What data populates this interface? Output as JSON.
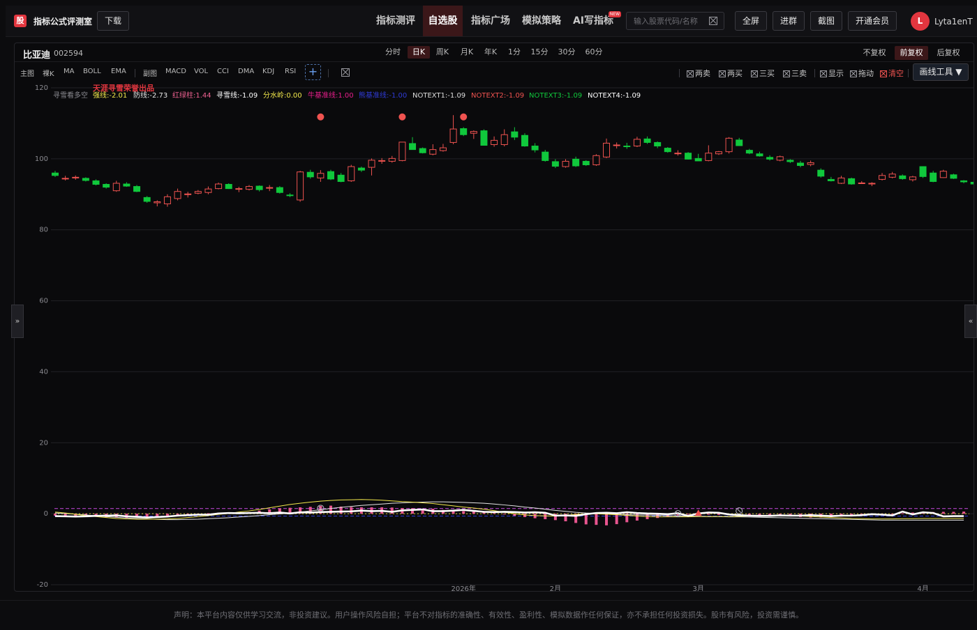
{
  "header": {
    "logo_char": "股",
    "app_title": "指标公式评测室",
    "download_label": "下载",
    "nav": [
      {
        "label": "指标测评",
        "active": false
      },
      {
        "label": "自选股",
        "active": true
      },
      {
        "label": "指标广场",
        "active": false
      },
      {
        "label": "模拟策略",
        "active": false
      },
      {
        "label": "AI写指标",
        "active": false
      }
    ],
    "new_badge": "NEW",
    "search_placeholder": "输入股票代码/名称",
    "buttons": [
      "全屏",
      "进群",
      "截图",
      "开通会员"
    ],
    "avatar_letter": "L",
    "username": "Lyta1enT"
  },
  "stock": {
    "name": "比亚迪",
    "code": "002594"
  },
  "periods": [
    {
      "label": "分时",
      "active": false
    },
    {
      "label": "日K",
      "active": true
    },
    {
      "label": "周K",
      "active": false
    },
    {
      "label": "月K",
      "active": false
    },
    {
      "label": "年K",
      "active": false
    },
    {
      "label": "1分",
      "active": false
    },
    {
      "label": "15分",
      "active": false
    },
    {
      "label": "30分",
      "active": false
    },
    {
      "label": "60分",
      "active": false
    }
  ],
  "adjustments": [
    {
      "label": "不复权",
      "active": false
    },
    {
      "label": "前复权",
      "active": true
    },
    {
      "label": "后复权",
      "active": false
    }
  ],
  "indicator_bar": {
    "main_label": "主图",
    "main_items": [
      "裸K",
      "MA",
      "BOLL",
      "EMA"
    ],
    "sub_label": "副图",
    "sub_items": [
      "MACD",
      "VOL",
      "CCI",
      "DMA",
      "KDJ",
      "RSI"
    ],
    "add_symbol": "+"
  },
  "tools": [
    {
      "label": "两卖",
      "clear": false
    },
    {
      "label": "两买",
      "clear": false
    },
    {
      "label": "三买",
      "clear": false
    },
    {
      "label": "三卖",
      "clear": false
    },
    {
      "label": "显示",
      "clear": false
    },
    {
      "label": "拖动",
      "clear": false
    },
    {
      "label": "清空",
      "clear": true
    }
  ],
  "draw_tools_label": "画线工具 ▼",
  "side_buttons": {
    "left": "»",
    "right": "«"
  },
  "colors": {
    "up": "#ef5350",
    "down": "#10c83c",
    "accent": "#e2363f",
    "gridline": "#222226"
  },
  "chart_data": {
    "type": "candlestick",
    "watermark": "天涯寻雪荣誉出品",
    "formula_name": "寻雪看多空",
    "legend": [
      {
        "name": "强线",
        "value": "-2.01",
        "color": "#f2e84b"
      },
      {
        "name": "防线",
        "value": "-2.73",
        "color": "#e6e6e6"
      },
      {
        "name": "红绿柱",
        "value": "1.44",
        "color": "#f06292"
      },
      {
        "name": "寻雪线",
        "value": "-1.09",
        "color": "#ffffff"
      },
      {
        "name": "分水岭",
        "value": "0.00",
        "color": "#f2e84b"
      },
      {
        "name": "牛基准线",
        "value": "1.00",
        "color": "#e91e8c"
      },
      {
        "name": "熊基准线",
        "value": "-1.00",
        "color": "#2f3bd6"
      },
      {
        "name": "NOTEXT1",
        "value": "-1.09",
        "color": "#dddddd"
      },
      {
        "name": "NOTEXT2",
        "value": "-1.09",
        "color": "#ef5350"
      },
      {
        "name": "NOTEXT3",
        "value": "-1.09",
        "color": "#10c83c"
      },
      {
        "name": "NOTEXT4",
        "value": "-1.09",
        "color": "#ffffff"
      }
    ],
    "y_ticks": [
      120,
      100,
      80,
      60,
      40,
      20,
      0,
      -20
    ],
    "ylim": [
      -20,
      120
    ],
    "x_labels": [
      {
        "label": "2026年",
        "index": 40
      },
      {
        "label": "2月",
        "index": 49
      },
      {
        "label": "3月",
        "index": 63
      },
      {
        "label": "4月",
        "index": 85
      }
    ],
    "candles": [
      [
        96.0,
        96.6,
        94.9,
        95.3
      ],
      [
        94.5,
        95.2,
        93.9,
        94.5
      ],
      [
        94.6,
        95.3,
        94.1,
        94.8
      ],
      [
        94.5,
        94.8,
        93.6,
        93.9
      ],
      [
        93.8,
        94.2,
        92.5,
        92.8
      ],
      [
        92.8,
        93.1,
        91.6,
        92.0
      ],
      [
        91.0,
        93.8,
        90.7,
        93.1
      ],
      [
        92.9,
        93.4,
        92.1,
        92.3
      ],
      [
        92.2,
        92.6,
        90.6,
        90.8
      ],
      [
        89.1,
        89.5,
        87.6,
        88.0
      ],
      [
        87.6,
        88.3,
        86.6,
        87.9
      ],
      [
        87.3,
        90.0,
        86.5,
        89.3
      ],
      [
        88.8,
        91.6,
        88.3,
        90.8
      ],
      [
        89.9,
        90.7,
        89.1,
        90.1
      ],
      [
        90.3,
        91.2,
        90.0,
        90.8
      ],
      [
        90.5,
        92.2,
        90.0,
        91.5
      ],
      [
        91.6,
        93.3,
        91.4,
        92.9
      ],
      [
        92.8,
        93.1,
        91.5,
        91.6
      ],
      [
        91.5,
        92.1,
        90.6,
        91.6
      ],
      [
        91.4,
        92.6,
        91.1,
        92.2
      ],
      [
        92.3,
        92.5,
        90.8,
        91.3
      ],
      [
        91.7,
        92.6,
        90.9,
        91.9
      ],
      [
        91.9,
        92.3,
        90.2,
        90.5
      ],
      [
        89.8,
        90.3,
        89.2,
        89.6
      ],
      [
        88.4,
        96.6,
        87.9,
        96.3
      ],
      [
        96.2,
        96.9,
        94.4,
        94.9
      ],
      [
        94.6,
        96.8,
        93.5,
        95.9
      ],
      [
        96.4,
        96.9,
        94.0,
        94.3
      ],
      [
        95.4,
        96.0,
        93.4,
        93.6
      ],
      [
        93.8,
        98.3,
        93.5,
        97.8
      ],
      [
        97.4,
        97.8,
        96.3,
        96.8
      ],
      [
        97.6,
        100.1,
        95.3,
        99.6
      ],
      [
        99.3,
        100.2,
        98.6,
        99.5
      ],
      [
        99.3,
        100.8,
        98.9,
        100.1
      ],
      [
        99.5,
        104.7,
        99.3,
        104.7
      ],
      [
        104.3,
        106.1,
        102.6,
        102.6
      ],
      [
        102.9,
        103.2,
        101.5,
        101.7
      ],
      [
        101.3,
        104.1,
        101.0,
        102.6
      ],
      [
        102.3,
        104.2,
        102.0,
        103.1
      ],
      [
        104.6,
        112.3,
        104.1,
        108.4
      ],
      [
        108.5,
        108.9,
        106.4,
        106.8
      ],
      [
        107.2,
        108.0,
        105.6,
        107.7
      ],
      [
        107.9,
        108.3,
        103.7,
        103.8
      ],
      [
        104.0,
        106.3,
        103.4,
        105.2
      ],
      [
        104.0,
        108.3,
        103.5,
        106.8
      ],
      [
        107.6,
        108.9,
        105.3,
        106.1
      ],
      [
        106.6,
        107.2,
        103.4,
        103.6
      ],
      [
        103.6,
        104.4,
        101.8,
        102.5
      ],
      [
        101.9,
        102.5,
        99.2,
        99.5
      ],
      [
        99.2,
        99.9,
        97.4,
        97.9
      ],
      [
        97.8,
        99.9,
        97.5,
        99.3
      ],
      [
        99.9,
        100.6,
        97.7,
        98.0
      ],
      [
        99.3,
        99.6,
        98.0,
        98.3
      ],
      [
        98.3,
        101.3,
        98.0,
        100.9
      ],
      [
        100.5,
        105.7,
        100.2,
        104.4
      ],
      [
        103.8,
        104.6,
        102.9,
        103.9
      ],
      [
        103.6,
        104.5,
        102.8,
        103.4
      ],
      [
        103.6,
        106.2,
        103.3,
        105.5
      ],
      [
        105.6,
        106.3,
        104.2,
        104.6
      ],
      [
        104.6,
        104.9,
        103.0,
        103.6
      ],
      [
        103.0,
        103.3,
        101.7,
        102.0
      ],
      [
        101.6,
        102.4,
        100.9,
        101.6
      ],
      [
        101.6,
        101.9,
        99.8,
        99.9
      ],
      [
        100.1,
        101.4,
        99.7,
        99.4
      ],
      [
        99.5,
        103.8,
        99.3,
        101.6
      ],
      [
        101.4,
        102.2,
        101.1,
        102.0
      ],
      [
        102.0,
        106.1,
        101.5,
        105.8
      ],
      [
        105.3,
        105.9,
        103.6,
        103.7
      ],
      [
        102.4,
        102.8,
        101.3,
        101.6
      ],
      [
        101.4,
        102.0,
        100.6,
        100.8
      ],
      [
        100.4,
        101.0,
        99.5,
        99.9
      ],
      [
        99.6,
        100.9,
        99.3,
        100.6
      ],
      [
        99.6,
        99.9,
        98.8,
        99.2
      ],
      [
        98.8,
        99.4,
        97.6,
        98.1
      ],
      [
        98.4,
        99.5,
        97.9,
        98.9
      ],
      [
        96.8,
        97.3,
        94.7,
        95.1
      ],
      [
        94.2,
        94.9,
        93.6,
        93.8
      ],
      [
        93.1,
        95.2,
        92.9,
        94.6
      ],
      [
        94.4,
        94.7,
        92.7,
        92.9
      ],
      [
        93.1,
        93.7,
        92.9,
        93.2
      ],
      [
        92.9,
        93.4,
        92.3,
        93.1
      ],
      [
        94.2,
        96.0,
        93.9,
        95.3
      ],
      [
        94.8,
        96.3,
        94.5,
        95.7
      ],
      [
        95.2,
        95.6,
        94.1,
        94.4
      ],
      [
        94.1,
        95.2,
        93.6,
        94.9
      ],
      [
        97.8,
        97.9,
        94.6,
        95.0
      ],
      [
        96.0,
        96.6,
        93.4,
        93.6
      ],
      [
        94.7,
        96.9,
        94.6,
        96.5
      ],
      [
        95.5,
        95.8,
        94.3,
        94.5
      ],
      [
        93.8,
        94.0,
        93.1,
        93.5
      ],
      [
        93.4,
        93.6,
        92.7,
        92.9
      ],
      [
        93.4,
        93.8,
        92.6,
        93.0
      ]
    ],
    "markers": [
      {
        "index": 26,
        "type": "dot",
        "value": 111.8
      },
      {
        "index": 34,
        "type": "dot",
        "value": 111.8
      },
      {
        "index": 40,
        "type": "dot",
        "value": 111.8
      }
    ],
    "indicator": {
      "bull_line": 1.0,
      "bear_line": -1.0,
      "zero_line": 0.0,
      "histogram": [
        -0.8,
        -0.9,
        -1.1,
        -1.2,
        -1.3,
        -1.5,
        -1.6,
        -1.8,
        -1.6,
        -1.3,
        -1.5,
        -1.2,
        -0.9,
        -0.6,
        -0.3,
        0.2,
        0.4,
        0.3,
        0.5,
        0.7,
        1.3,
        1.8,
        2.2,
        2.5,
        2.7,
        2.9,
        3.3,
        3.4,
        3.0,
        2.8,
        2.7,
        2.7,
        2.7,
        2.6,
        2.4,
        2.3,
        2.1,
        2.1,
        1.6,
        1.2,
        1.1,
        0.9,
        0.6,
        0.3,
        -0.3,
        -0.9,
        -1.4,
        -1.9,
        -2.3,
        -2.7,
        -3.2,
        -3.9,
        -4.5,
        -4.7,
        -4.9,
        -4.4,
        -3.6,
        -2.9,
        -2.3,
        -1.8,
        -1.3,
        -0.7,
        -0.1,
        0.0,
        -0.4,
        -0.5,
        -0.6,
        -0.6,
        -0.7,
        -0.8,
        -0.8,
        -0.9,
        -1.1,
        -1.4,
        -1.6,
        -1.6,
        -1.4,
        -1.2,
        -1.0,
        -0.7,
        -0.4,
        -0.2,
        -0.1,
        0.2,
        0.5,
        0.7,
        0.7,
        0.8,
        0.8,
        0.9
      ],
      "xunxue": [
        -1.0,
        -1.1,
        -1.2,
        -1.1,
        -0.9,
        -0.8,
        -0.7,
        -1.1,
        -1.3,
        -1.6,
        -1.4,
        -1.2,
        -0.8,
        -0.6,
        -0.4,
        -0.4,
        0.1,
        0.3,
        0.2,
        0.3,
        0.4,
        0.2,
        0.5,
        0.1,
        0.6,
        0.5,
        0.7,
        0.8,
        0.9,
        1.0,
        1.3,
        1.1,
        1.2,
        0.8,
        1.4,
        1.6,
        1.8,
        1.1,
        1.1,
        1.3,
        1.6,
        1.2,
        0.8,
        0.7,
        0.8,
        0.7,
        0.5,
        0.6,
        0.4,
        -0.8,
        -0.7,
        -0.9,
        -0.2,
        0.3,
        0.4,
        0.2,
        0.6,
        0.3,
        0.1,
        0.0,
        -0.2,
        0.2,
        -0.9,
        0.1,
        0.5,
        0.4,
        -0.3,
        -0.6,
        -0.8,
        -0.9,
        -0.9,
        -0.7,
        -0.8,
        -0.8,
        -0.6,
        -0.8,
        -1.0,
        -0.8,
        -0.8,
        -0.6,
        -0.2,
        -0.4,
        -0.7,
        0.9,
        -0.3,
        0.6,
        0.3,
        -1.1,
        -1.0,
        -1.0
      ],
      "strong": [
        0.7,
        0.3,
        -0.2,
        -0.8,
        -1.2,
        -1.6,
        -2.0,
        -2.2,
        -2.3,
        -2.3,
        -2.3,
        -2.2,
        -2.0,
        -1.6,
        -1.2,
        -0.8,
        -0.3,
        0.1,
        0.7,
        1.2,
        1.8,
        2.5,
        3.2,
        3.9,
        4.4,
        4.9,
        5.3,
        5.6,
        5.8,
        5.9,
        6.0,
        5.9,
        5.7,
        5.4,
        5.1,
        4.9,
        4.6,
        4.3,
        3.8,
        3.3,
        2.8,
        2.4,
        1.9,
        1.3,
        0.6,
        0.0,
        -0.5,
        -0.8,
        -0.9,
        -1.0,
        -0.7,
        -0.3,
        -0.1,
        0.0,
        -0.2,
        -0.4,
        -0.7,
        -1.0,
        -1.2,
        -1.3,
        -1.3,
        -1.3,
        -1.3,
        -1.2,
        -1.2,
        -1.2,
        -1.2,
        -1.1,
        -1.0,
        -1.0,
        -1.0,
        -1.0,
        -1.0,
        -1.0,
        -1.2,
        -1.4,
        -1.6,
        -1.8,
        -2.0,
        -2.1,
        -2.2,
        -2.2,
        -2.2,
        -2.1,
        -2.1,
        -2.0,
        -2.0,
        -2.0,
        -2.0,
        -2.0
      ],
      "defense": [
        0.3,
        0.1,
        -0.2,
        -0.5,
        -0.9,
        -1.2,
        -1.5,
        -1.8,
        -2.0,
        -2.2,
        -2.4,
        -2.5,
        -2.5,
        -2.4,
        -2.3,
        -2.1,
        -1.9,
        -1.7,
        -1.4,
        -1.1,
        -0.8,
        -0.4,
        -0.1,
        0.3,
        0.7,
        1.2,
        1.7,
        2.2,
        2.7,
        3.1,
        3.5,
        3.8,
        4.1,
        4.4,
        4.6,
        4.8,
        4.9,
        5.0,
        5.0,
        4.9,
        4.8,
        4.6,
        4.4,
        4.1,
        3.7,
        3.3,
        2.8,
        2.4,
        1.9,
        1.4,
        1.0,
        0.6,
        0.3,
        0.1,
        -0.1,
        -0.3,
        -0.4,
        -0.5,
        -0.6,
        -0.7,
        -0.8,
        -0.9,
        -1.0,
        -1.1,
        -1.2,
        -1.2,
        -1.3,
        -1.3,
        -1.4,
        -1.5,
        -1.6,
        -1.7,
        -1.8,
        -1.9,
        -2.0,
        -2.1,
        -2.2,
        -2.3,
        -2.4,
        -2.5,
        -2.6,
        -2.7,
        -2.7,
        -2.7,
        -2.7,
        -2.7,
        -2.7,
        -2.7,
        -2.7,
        -2.7
      ],
      "markers": [
        {
          "index": 26,
          "type": "circle-cross",
          "value": 2.3
        },
        {
          "index": 61,
          "type": "circle-cross",
          "value": 0.0
        },
        {
          "index": 63,
          "type": "triangle-up",
          "value": 0.0
        },
        {
          "index": 67,
          "type": "circle-cross",
          "value": 1.2
        }
      ]
    },
    "grid": true
  },
  "footer": {
    "disclaimer": "声明：本平台内容仅供学习交流，非投资建议。用户操作风险自担；平台不对指标的准确性、有效性、盈利性、模拟数据作任何保证，亦不承担任何投资损失。股市有风险，投资需谨慎。"
  }
}
